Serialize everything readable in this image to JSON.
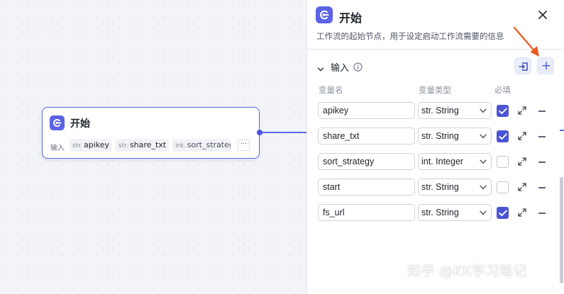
{
  "canvas": {
    "node": {
      "title": "开始",
      "input_label": "输入",
      "chips": [
        {
          "type": "str.",
          "name": "apikey"
        },
        {
          "type": "str.",
          "name": "share_txt"
        },
        {
          "type": "int.",
          "name": "sort_strategy"
        }
      ],
      "more_label": "···"
    }
  },
  "panel": {
    "title": "开始",
    "description": "工作流的起始节点，用于设定启动工作流需要的信息",
    "section": {
      "title": "输入",
      "columns": {
        "name": "变量名",
        "type": "变量类型",
        "required": "必填"
      },
      "variables": [
        {
          "name": "apikey",
          "type": "str. String",
          "required": true
        },
        {
          "name": "share_txt",
          "type": "str. String",
          "required": true
        },
        {
          "name": "sort_strategy",
          "type": "int. Integer",
          "required": false
        },
        {
          "name": "start",
          "type": "str. String",
          "required": false
        },
        {
          "name": "fs_url",
          "type": "str. String",
          "required": true
        }
      ]
    }
  },
  "watermark": "知乎 @KK学习笔记",
  "colors": {
    "accent": "#4b55d4",
    "annotation": "#ea5a1c"
  },
  "icons": [
    "start-node-icon",
    "close-icon",
    "chevron-down-icon",
    "info-icon",
    "import-icon",
    "plus-icon",
    "checkmark-icon",
    "expand-icon",
    "minus-icon"
  ]
}
